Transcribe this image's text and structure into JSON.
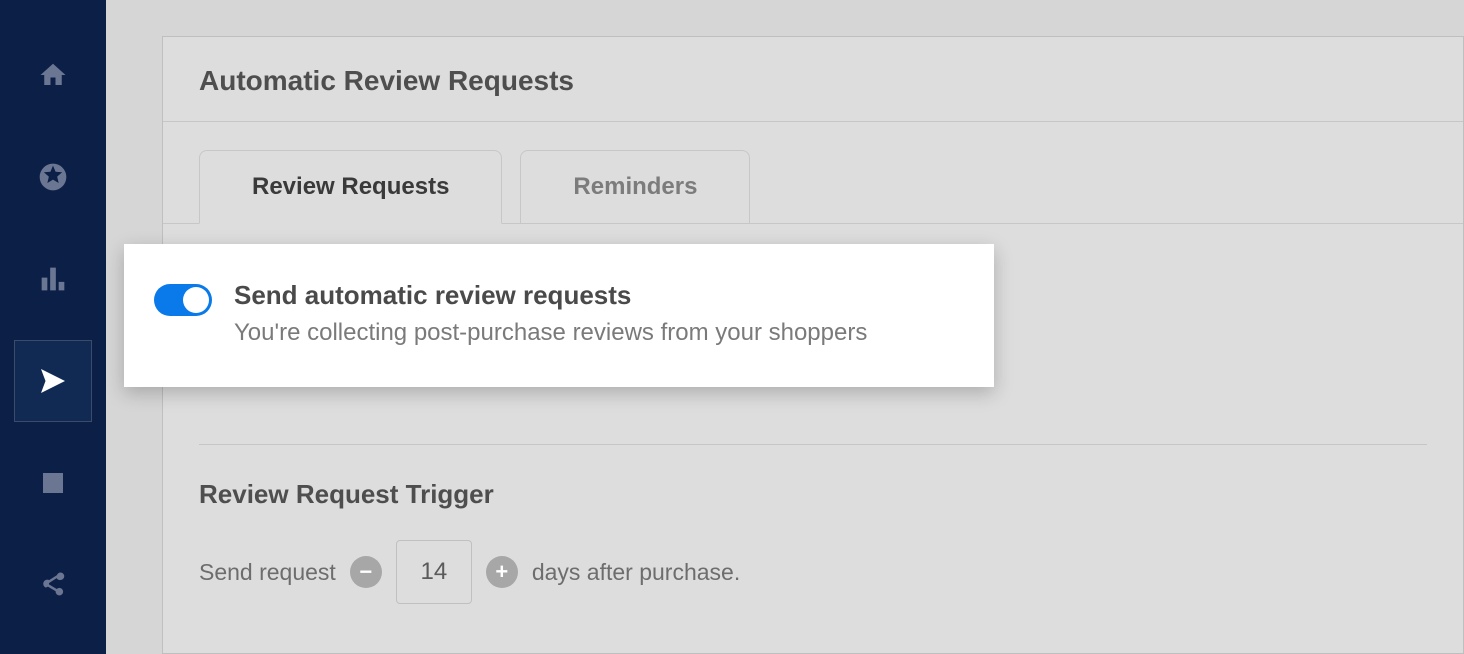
{
  "sidebar": {
    "items": [
      {
        "name": "home"
      },
      {
        "name": "star"
      },
      {
        "name": "analytics"
      },
      {
        "name": "send",
        "active": true
      },
      {
        "name": "notes"
      },
      {
        "name": "share"
      }
    ]
  },
  "panel": {
    "title": "Automatic Review Requests",
    "tabs": [
      {
        "label": "Review Requests",
        "active": true
      },
      {
        "label": "Reminders",
        "active": false
      }
    ]
  },
  "toggle_card": {
    "title": "Send automatic review requests",
    "description": "You're collecting post-purchase reviews from your shoppers",
    "enabled": true
  },
  "trigger": {
    "title": "Review Request Trigger",
    "prefix": "Send request",
    "days": "14",
    "suffix": "days after purchase."
  }
}
